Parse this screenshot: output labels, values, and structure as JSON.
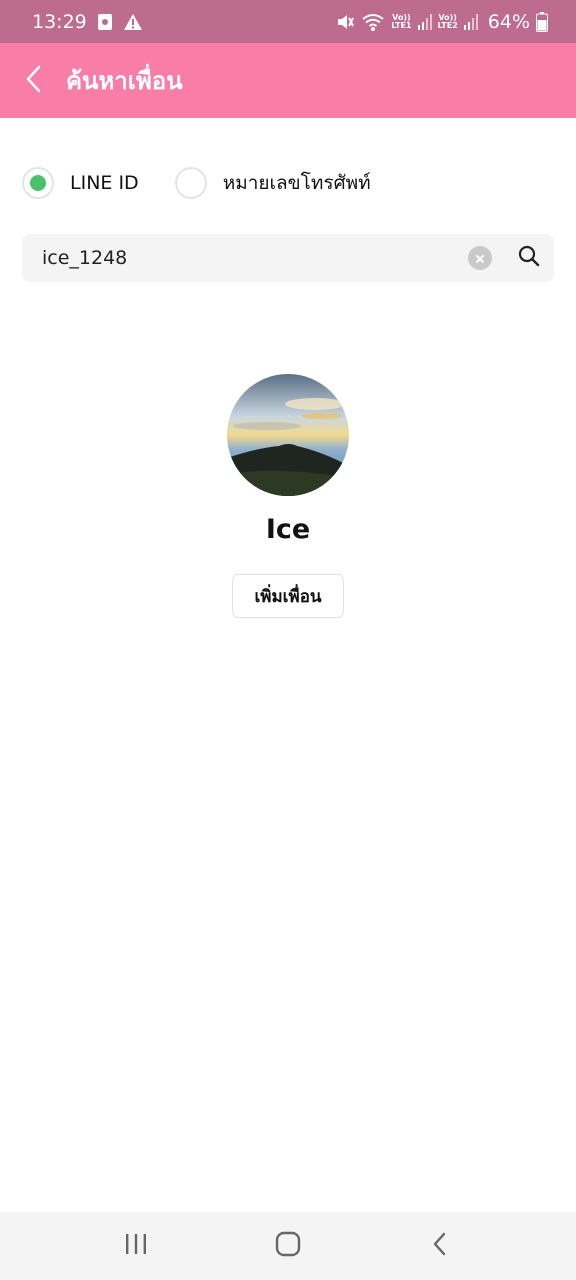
{
  "status_bar": {
    "time": "13:29",
    "lte1": [
      "VoLTE",
      "LTE1"
    ],
    "lte2": [
      "VoLTE",
      "LTE2"
    ],
    "lte1_top": "Vo))",
    "lte1_bottom": "LTE1",
    "lte2_top": "Vo))",
    "lte2_bottom": "LTE2",
    "battery": "64%",
    "icons": [
      "screen-record-icon",
      "warning-icon",
      "mute-icon",
      "wifi-icon",
      "signal-icon",
      "battery-icon"
    ]
  },
  "app_bar": {
    "title": "ค้นหาเพื่อน",
    "color": "#f87ea8"
  },
  "search_type": {
    "options": [
      {
        "label": "LINE ID",
        "selected": true
      },
      {
        "label": "หมายเลขโทรศัพท์",
        "selected": false
      }
    ],
    "selected_color": "#4ac26b"
  },
  "search": {
    "value": "ice_1248"
  },
  "result": {
    "name": "Ice",
    "add_button_label": "เพิ่มเพื่อน"
  },
  "nav_bar": {
    "icons": [
      "recent-apps-icon",
      "home-icon",
      "back-icon"
    ]
  }
}
